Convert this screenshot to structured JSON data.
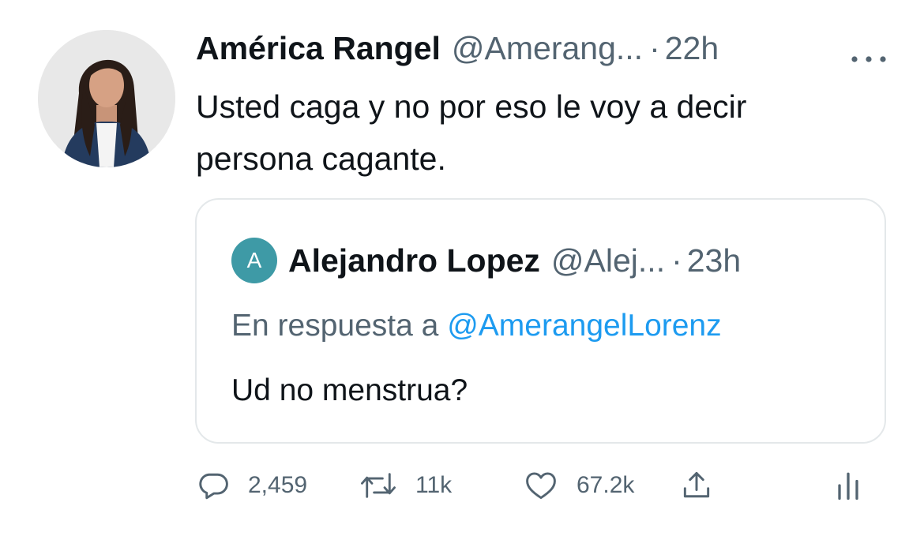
{
  "tweet": {
    "author_name": "América Rangel",
    "author_handle": "@Amerang...",
    "separator": "·",
    "time": "22h",
    "body_line1": "Usted caga y no por eso le voy a decir",
    "body_line2": "persona cagante."
  },
  "quoted": {
    "avatar_letter": "A",
    "avatar_color": "#3e9aa6",
    "author_name": "Alejandro Lopez",
    "author_handle": "@Alej...",
    "separator": "·",
    "time": "23h",
    "reply_prefix": "En respuesta a",
    "reply_mention": "@AmerangelLorenz",
    "text": "Ud no menstrua?"
  },
  "actions": {
    "replies": "2,459",
    "retweets": "11k",
    "likes": "67.2k"
  },
  "icons": {
    "more": "more-dots-icon",
    "reply": "speech-bubble-icon",
    "retweet": "retweet-arrows-icon",
    "like": "heart-icon",
    "share": "share-upload-icon",
    "analytics": "bar-chart-icon"
  },
  "colors": {
    "text": "#0f1419",
    "secondary": "#536471",
    "link": "#1d9bf0",
    "border": "#e4e8ea"
  }
}
